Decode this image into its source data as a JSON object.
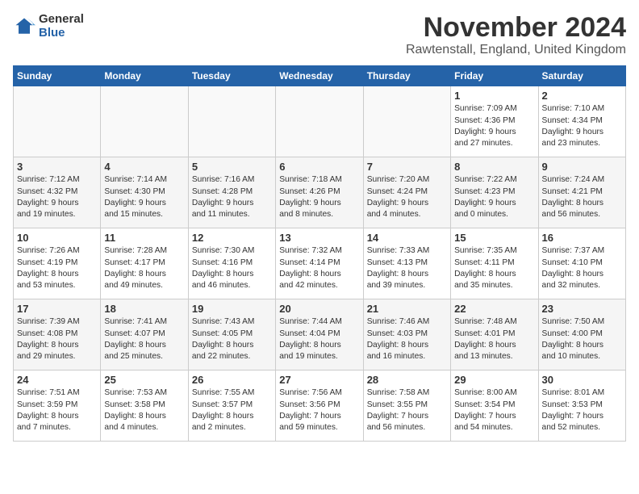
{
  "logo": {
    "general": "General",
    "blue": "Blue",
    "icon_color": "#2563a8"
  },
  "header": {
    "month_title": "November 2024",
    "location": "Rawtenstall, England, United Kingdom"
  },
  "weekdays": [
    "Sunday",
    "Monday",
    "Tuesday",
    "Wednesday",
    "Thursday",
    "Friday",
    "Saturday"
  ],
  "weeks": [
    [
      {
        "day": "",
        "info": ""
      },
      {
        "day": "",
        "info": ""
      },
      {
        "day": "",
        "info": ""
      },
      {
        "day": "",
        "info": ""
      },
      {
        "day": "",
        "info": ""
      },
      {
        "day": "1",
        "info": "Sunrise: 7:09 AM\nSunset: 4:36 PM\nDaylight: 9 hours\nand 27 minutes."
      },
      {
        "day": "2",
        "info": "Sunrise: 7:10 AM\nSunset: 4:34 PM\nDaylight: 9 hours\nand 23 minutes."
      }
    ],
    [
      {
        "day": "3",
        "info": "Sunrise: 7:12 AM\nSunset: 4:32 PM\nDaylight: 9 hours\nand 19 minutes."
      },
      {
        "day": "4",
        "info": "Sunrise: 7:14 AM\nSunset: 4:30 PM\nDaylight: 9 hours\nand 15 minutes."
      },
      {
        "day": "5",
        "info": "Sunrise: 7:16 AM\nSunset: 4:28 PM\nDaylight: 9 hours\nand 11 minutes."
      },
      {
        "day": "6",
        "info": "Sunrise: 7:18 AM\nSunset: 4:26 PM\nDaylight: 9 hours\nand 8 minutes."
      },
      {
        "day": "7",
        "info": "Sunrise: 7:20 AM\nSunset: 4:24 PM\nDaylight: 9 hours\nand 4 minutes."
      },
      {
        "day": "8",
        "info": "Sunrise: 7:22 AM\nSunset: 4:23 PM\nDaylight: 9 hours\nand 0 minutes."
      },
      {
        "day": "9",
        "info": "Sunrise: 7:24 AM\nSunset: 4:21 PM\nDaylight: 8 hours\nand 56 minutes."
      }
    ],
    [
      {
        "day": "10",
        "info": "Sunrise: 7:26 AM\nSunset: 4:19 PM\nDaylight: 8 hours\nand 53 minutes."
      },
      {
        "day": "11",
        "info": "Sunrise: 7:28 AM\nSunset: 4:17 PM\nDaylight: 8 hours\nand 49 minutes."
      },
      {
        "day": "12",
        "info": "Sunrise: 7:30 AM\nSunset: 4:16 PM\nDaylight: 8 hours\nand 46 minutes."
      },
      {
        "day": "13",
        "info": "Sunrise: 7:32 AM\nSunset: 4:14 PM\nDaylight: 8 hours\nand 42 minutes."
      },
      {
        "day": "14",
        "info": "Sunrise: 7:33 AM\nSunset: 4:13 PM\nDaylight: 8 hours\nand 39 minutes."
      },
      {
        "day": "15",
        "info": "Sunrise: 7:35 AM\nSunset: 4:11 PM\nDaylight: 8 hours\nand 35 minutes."
      },
      {
        "day": "16",
        "info": "Sunrise: 7:37 AM\nSunset: 4:10 PM\nDaylight: 8 hours\nand 32 minutes."
      }
    ],
    [
      {
        "day": "17",
        "info": "Sunrise: 7:39 AM\nSunset: 4:08 PM\nDaylight: 8 hours\nand 29 minutes."
      },
      {
        "day": "18",
        "info": "Sunrise: 7:41 AM\nSunset: 4:07 PM\nDaylight: 8 hours\nand 25 minutes."
      },
      {
        "day": "19",
        "info": "Sunrise: 7:43 AM\nSunset: 4:05 PM\nDaylight: 8 hours\nand 22 minutes."
      },
      {
        "day": "20",
        "info": "Sunrise: 7:44 AM\nSunset: 4:04 PM\nDaylight: 8 hours\nand 19 minutes."
      },
      {
        "day": "21",
        "info": "Sunrise: 7:46 AM\nSunset: 4:03 PM\nDaylight: 8 hours\nand 16 minutes."
      },
      {
        "day": "22",
        "info": "Sunrise: 7:48 AM\nSunset: 4:01 PM\nDaylight: 8 hours\nand 13 minutes."
      },
      {
        "day": "23",
        "info": "Sunrise: 7:50 AM\nSunset: 4:00 PM\nDaylight: 8 hours\nand 10 minutes."
      }
    ],
    [
      {
        "day": "24",
        "info": "Sunrise: 7:51 AM\nSunset: 3:59 PM\nDaylight: 8 hours\nand 7 minutes."
      },
      {
        "day": "25",
        "info": "Sunrise: 7:53 AM\nSunset: 3:58 PM\nDaylight: 8 hours\nand 4 minutes."
      },
      {
        "day": "26",
        "info": "Sunrise: 7:55 AM\nSunset: 3:57 PM\nDaylight: 8 hours\nand 2 minutes."
      },
      {
        "day": "27",
        "info": "Sunrise: 7:56 AM\nSunset: 3:56 PM\nDaylight: 7 hours\nand 59 minutes."
      },
      {
        "day": "28",
        "info": "Sunrise: 7:58 AM\nSunset: 3:55 PM\nDaylight: 7 hours\nand 56 minutes."
      },
      {
        "day": "29",
        "info": "Sunrise: 8:00 AM\nSunset: 3:54 PM\nDaylight: 7 hours\nand 54 minutes."
      },
      {
        "day": "30",
        "info": "Sunrise: 8:01 AM\nSunset: 3:53 PM\nDaylight: 7 hours\nand 52 minutes."
      }
    ]
  ]
}
